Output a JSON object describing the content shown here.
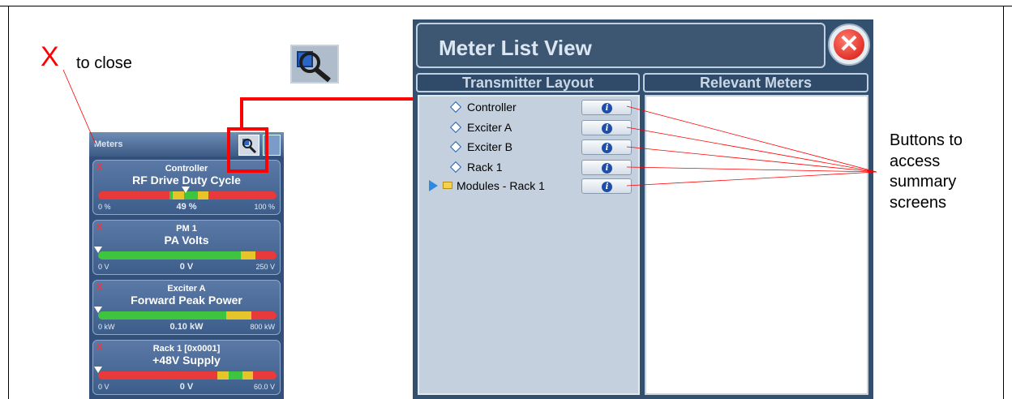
{
  "annotations": {
    "close_symbol": "X",
    "close_text": "to close",
    "buttons_line1": "Buttons to",
    "buttons_line2": "access",
    "buttons_line3": "summary",
    "buttons_line4": "screens"
  },
  "meters_panel": {
    "title": "Meters",
    "meters": [
      {
        "source": "Controller",
        "name": "RF Drive Duty Cycle",
        "min": "0 %",
        "value": "49 %",
        "max": "100 %",
        "level": 0.49
      },
      {
        "source": "PM 1",
        "name": "PA Volts",
        "min": "0 V",
        "value": "0 V",
        "max": "250 V",
        "level": 0.0
      },
      {
        "source": "Exciter A",
        "name": "Forward Peak Power",
        "min": "0 kW",
        "value": "0.10 kW",
        "max": "800 kW",
        "level": 0.0
      },
      {
        "source": "Rack 1 [0x0001]",
        "name": "+48V Supply",
        "min": "0 V",
        "value": "0 V",
        "max": "60.0 V",
        "level": 0.0
      }
    ],
    "close_marker": "X"
  },
  "meter_list_view": {
    "title": "Meter List View",
    "close_icon": "close-icon",
    "col_left": "Transmitter Layout",
    "col_right": "Relevant Meters",
    "tree": [
      {
        "label": "Controller",
        "kind": "item"
      },
      {
        "label": "Exciter A",
        "kind": "item"
      },
      {
        "label": "Exciter B",
        "kind": "item"
      },
      {
        "label": "Rack 1",
        "kind": "item"
      },
      {
        "label": "Modules - Rack 1",
        "kind": "folder"
      }
    ],
    "info_icon": "info-icon"
  },
  "colors": {
    "annotation_red": "#ff0000",
    "panel_blue": "#33506f",
    "meter_green": "#3ec43e",
    "meter_yellow": "#e6c52a",
    "meter_red": "#e83a3a"
  }
}
